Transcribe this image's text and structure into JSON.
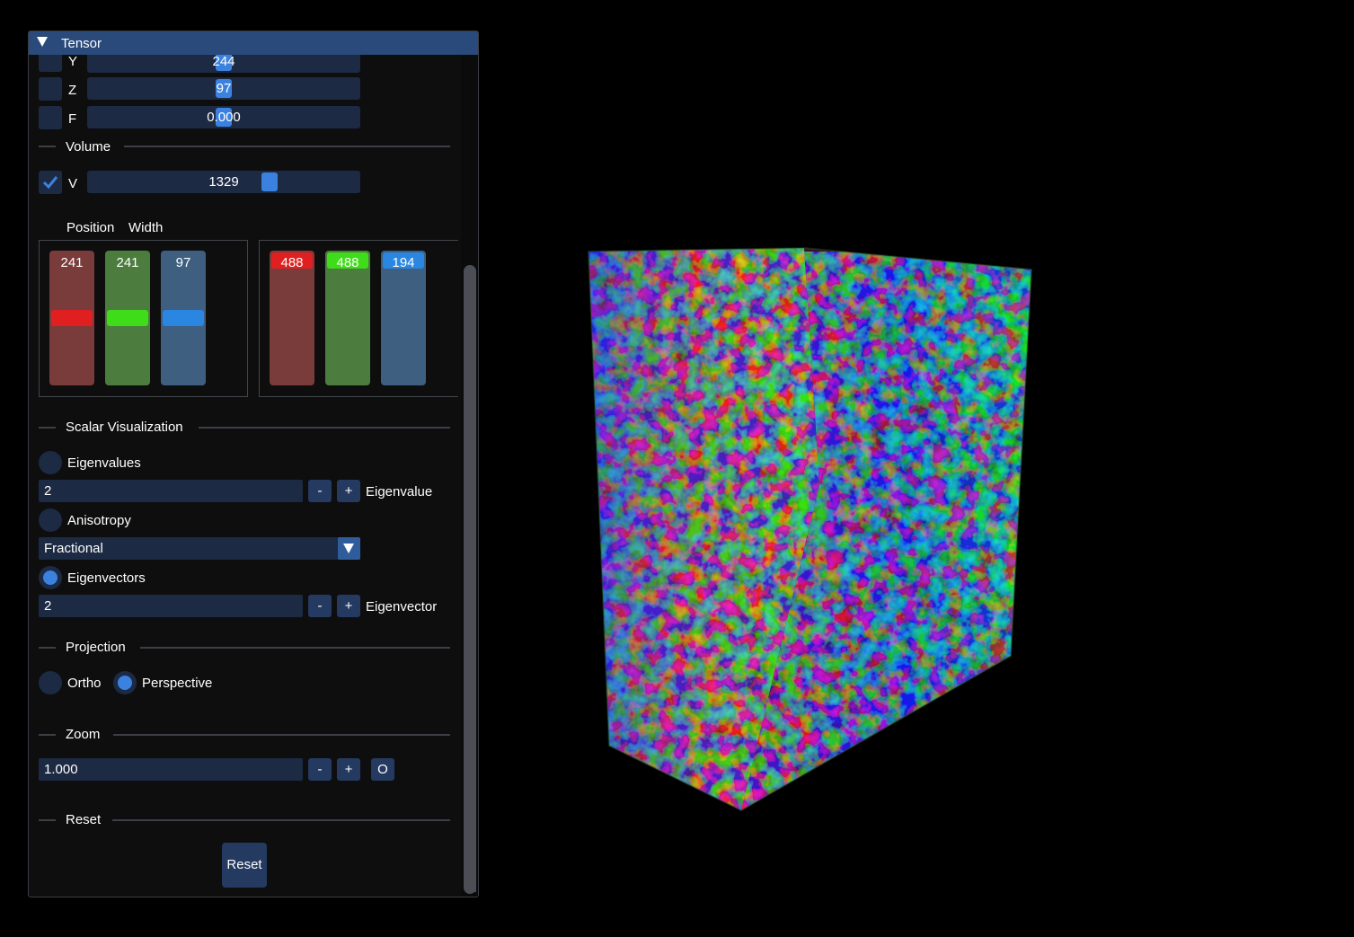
{
  "window": {
    "title": "Tensor"
  },
  "slices": [
    {
      "axis": "Y",
      "value": "244",
      "grab_fraction": 0.5
    },
    {
      "axis": "Z",
      "value": "97",
      "grab_fraction": 0.5
    },
    {
      "axis": "F",
      "value": "0.000",
      "grab_fraction": 0.5
    }
  ],
  "volume": {
    "section": "Volume",
    "label": "V",
    "checked": true,
    "value": "1329",
    "grab_fraction": 0.68
  },
  "position_width": {
    "position_label": "Position",
    "width_label": "Width",
    "position": [
      {
        "value": "241",
        "color": "#e02020",
        "track": "#7a3b3b"
      },
      {
        "value": "241",
        "color": "#3fdc1a",
        "track": "#4d7d3e"
      },
      {
        "value": "97",
        "color": "#2a86e0",
        "track": "#3e5f80"
      }
    ],
    "width": [
      {
        "value": "488",
        "color": "#e02020",
        "track": "#7a3b3b"
      },
      {
        "value": "488",
        "color": "#3fdc1a",
        "track": "#4d7d3e"
      },
      {
        "value": "194",
        "color": "#2a86e0",
        "track": "#3e5f80"
      }
    ]
  },
  "scalar": {
    "section": "Scalar Visualization",
    "eigenvalues_label": "Eigenvalues",
    "eigenvalue_field": "2",
    "eigenvalue_label": "Eigenvalue",
    "anisotropy_label": "Anisotropy",
    "anisotropy_selected": "Fractional",
    "eigenvectors_label": "Eigenvectors",
    "eigenvector_field": "2",
    "eigenvector_label": "Eigenvector",
    "selected": "Eigenvectors",
    "minus": "-",
    "plus": "+"
  },
  "projection": {
    "section": "Projection",
    "ortho_label": "Ortho",
    "perspective_label": "Perspective",
    "selected": "Perspective"
  },
  "zoom": {
    "section": "Zoom",
    "value": "1.000",
    "minus": "-",
    "plus": "+",
    "reset_glyph": "O"
  },
  "reset": {
    "section": "Reset",
    "button_label": "Reset"
  },
  "colors": {
    "accent": "#3b82e0",
    "titlebar": "#294a7a",
    "widget_bg": "#1d2a44",
    "panel_bg": "#0e0e0f"
  }
}
